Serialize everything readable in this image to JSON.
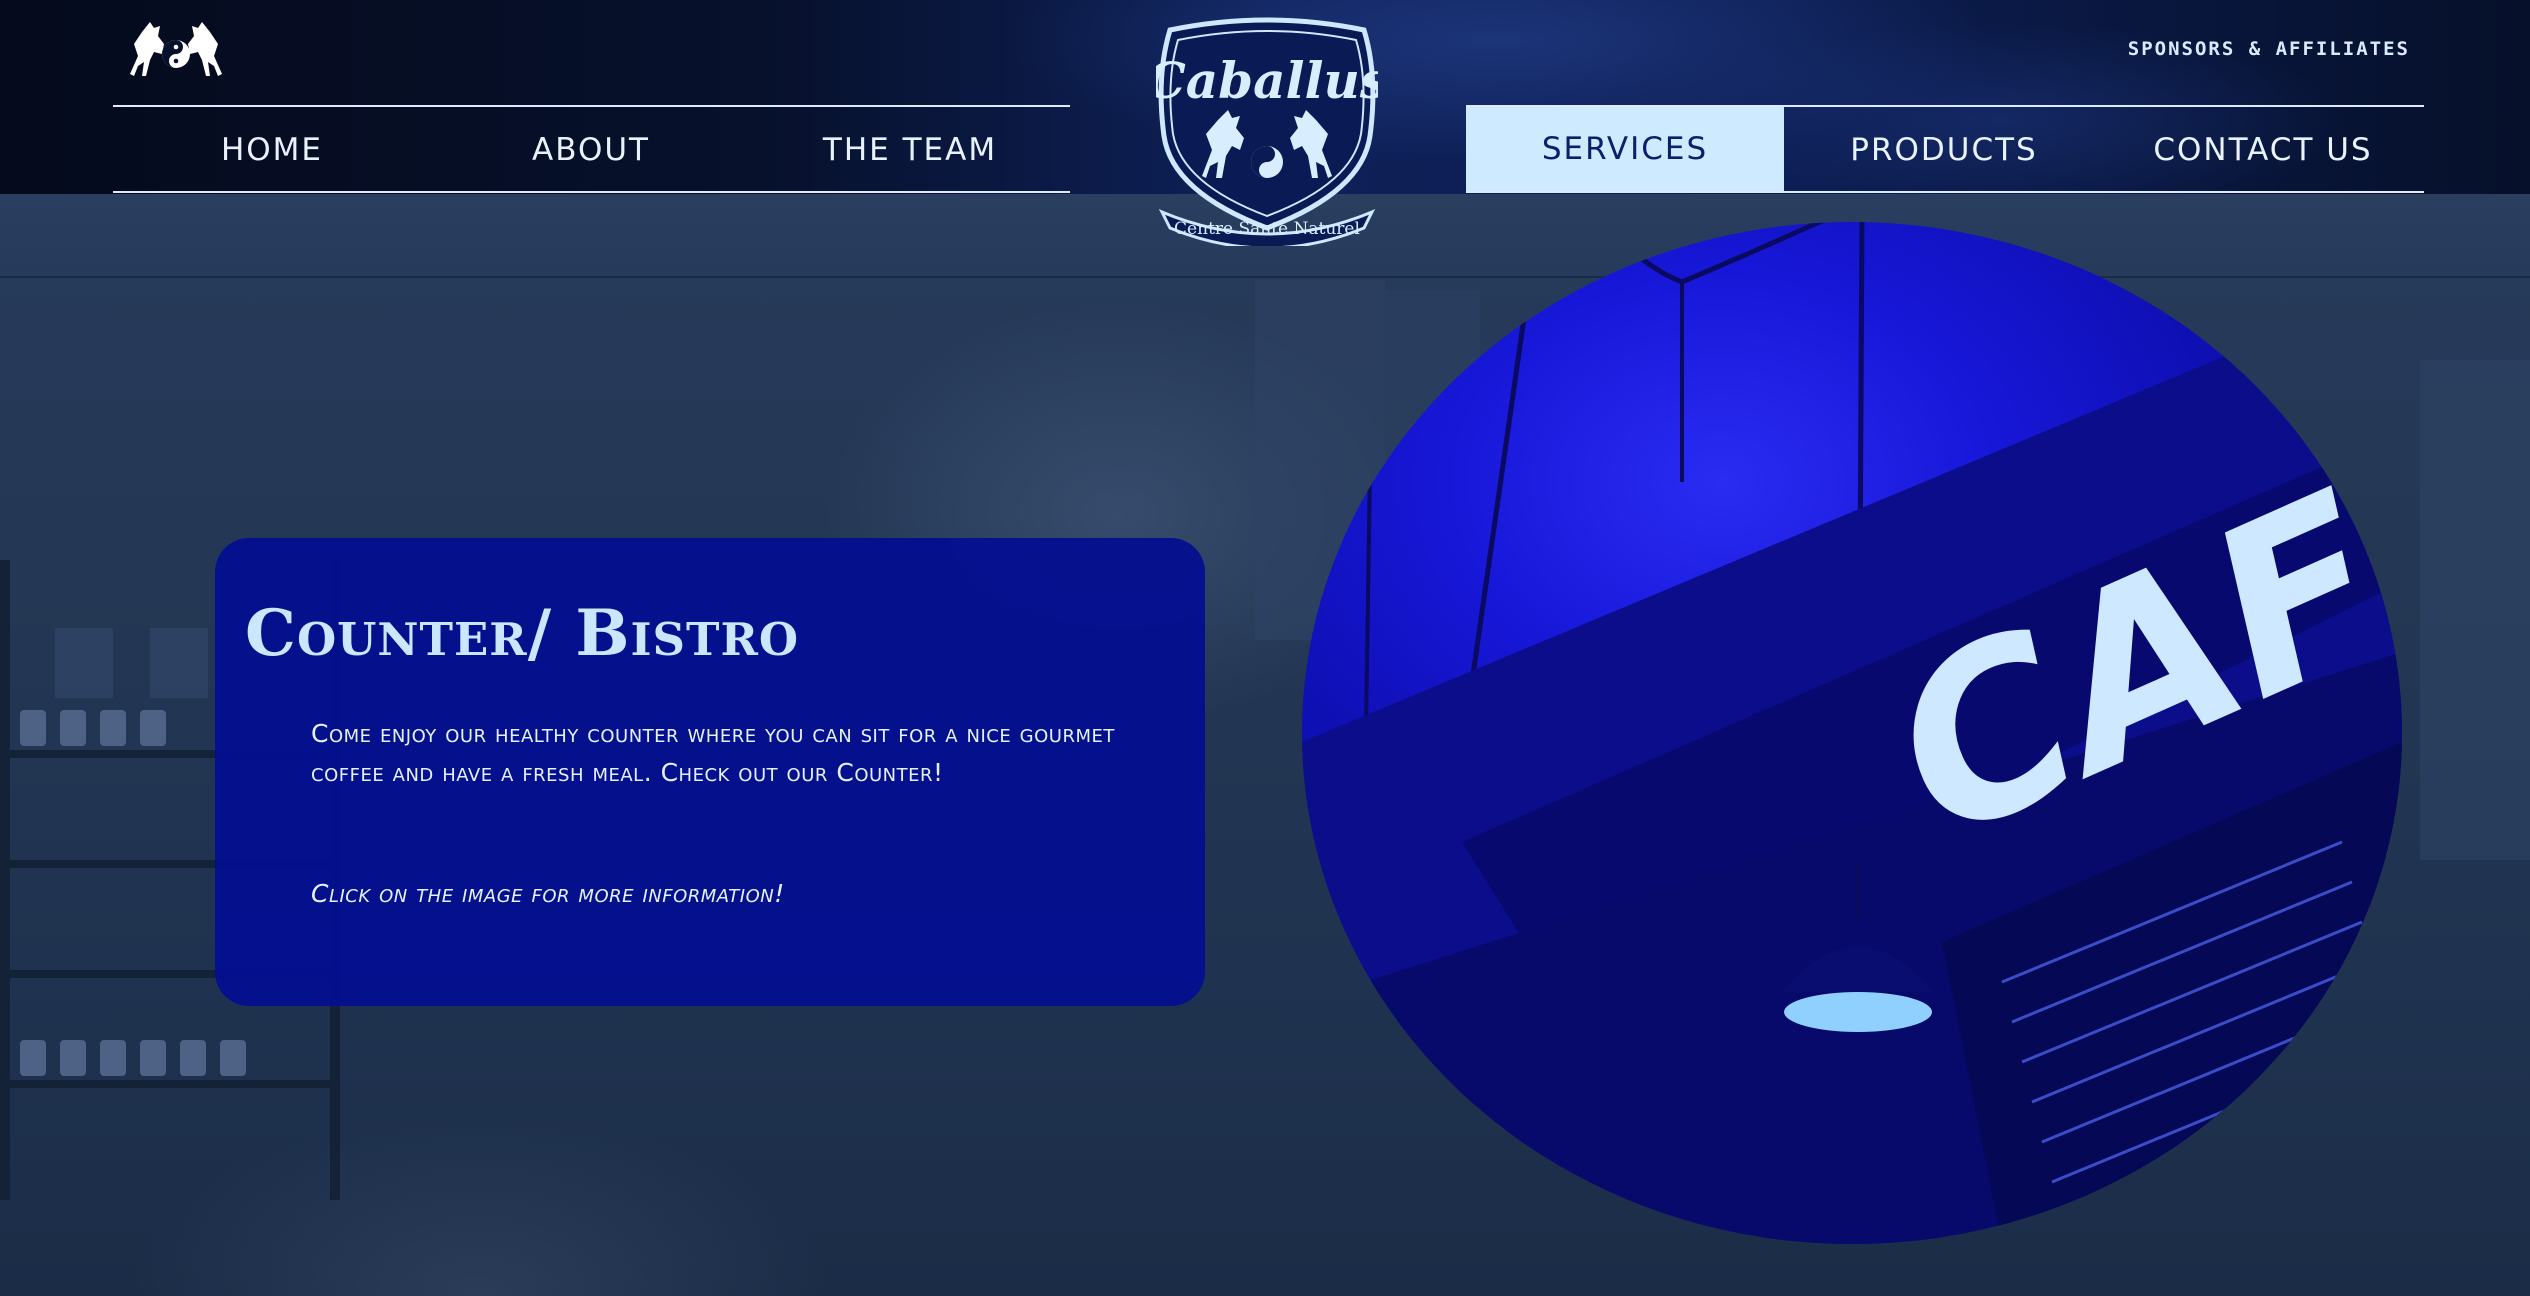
{
  "header": {
    "corner_logo_icon": "rearing-horses-yin-yang-icon",
    "sponsors_label": "SPONSORS & AFFILIATES",
    "nav_left": [
      {
        "label": "HOME"
      },
      {
        "label": "ABOUT"
      },
      {
        "label": "THE TEAM"
      }
    ],
    "nav_right": [
      {
        "label": "SERVICES",
        "active": true
      },
      {
        "label": "PRODUCTS"
      },
      {
        "label": "CONTACT US"
      }
    ],
    "crest": {
      "name": "Caballus",
      "tagline": "Centre Sante Naturel",
      "icon": "caballus-crest-icon"
    }
  },
  "card": {
    "title": "Counter/ Bistro",
    "body": "Come enjoy our healthy counter where you can sit for a nice gourmet coffee and have a fresh meal.  Check out our Counter!",
    "note": "Click on the image for more information!"
  },
  "image": {
    "sign_text": "CAFE",
    "icon": "cafe-sign-photo"
  },
  "colors": {
    "header_bg": "#07112c",
    "nav_active_bg": "#cdeaff",
    "nav_active_text": "#0d1f6a",
    "card_bg": "#030e91",
    "title_color": "#cbe7ff",
    "circle_blue": "#1717d8"
  }
}
